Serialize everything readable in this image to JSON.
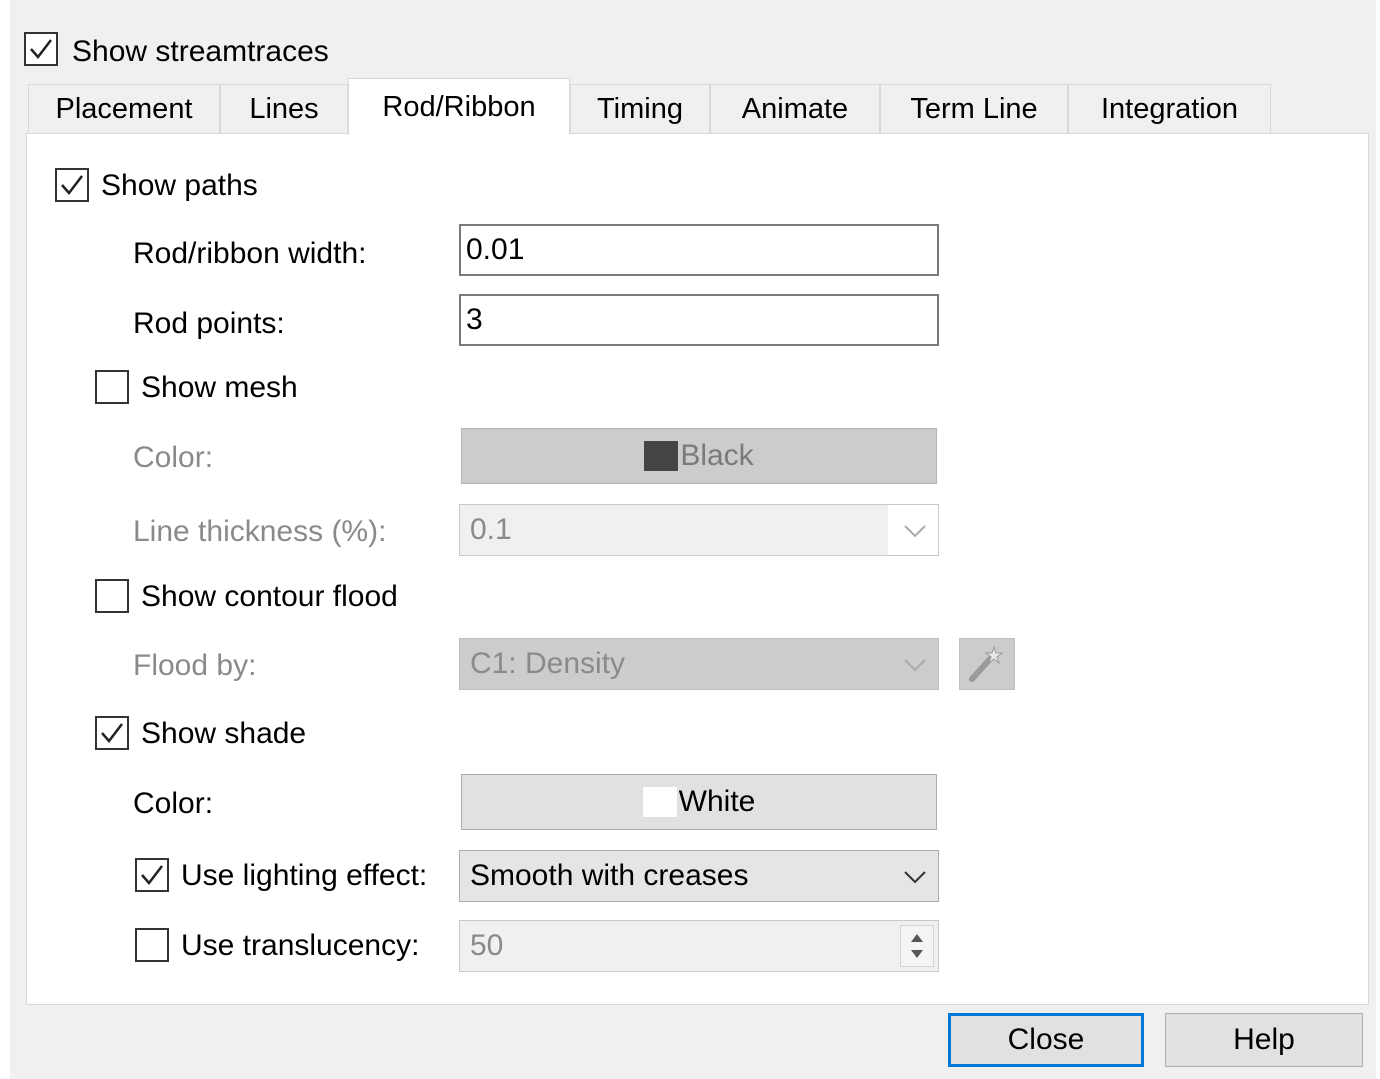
{
  "show_streamtraces": {
    "label": "Show streamtraces",
    "checked": true
  },
  "tabs": [
    {
      "label": "Placement",
      "active": false
    },
    {
      "label": "Lines",
      "active": false
    },
    {
      "label": "Rod/Ribbon",
      "active": true
    },
    {
      "label": "Timing",
      "active": false
    },
    {
      "label": "Animate",
      "active": false
    },
    {
      "label": "Term Line",
      "active": false
    },
    {
      "label": "Integration",
      "active": false
    }
  ],
  "panel": {
    "show_paths": {
      "label": "Show paths",
      "checked": true
    },
    "rod_ribbon_width": {
      "label": "Rod/ribbon width:",
      "value": "0.01"
    },
    "rod_points": {
      "label": "Rod points:",
      "value": "3"
    },
    "show_mesh": {
      "label": "Show mesh",
      "checked": false
    },
    "mesh_color": {
      "label": "Color:",
      "value": "Black",
      "swatch": "#444444"
    },
    "line_thickness": {
      "label": "Line thickness (%):",
      "value": "0.1"
    },
    "show_contour_flood": {
      "label": "Show contour flood",
      "checked": false
    },
    "flood_by": {
      "label": "Flood by:",
      "value": "C1: Density"
    },
    "show_shade": {
      "label": "Show shade",
      "checked": true
    },
    "shade_color": {
      "label": "Color:",
      "value": "White",
      "swatch": "#ffffff"
    },
    "use_lighting_effect": {
      "label": "Use lighting effect:",
      "checked": true,
      "value": "Smooth with creases"
    },
    "use_translucency": {
      "label": "Use translucency:",
      "checked": false,
      "value": "50"
    }
  },
  "buttons": {
    "close": "Close",
    "help": "Help"
  }
}
